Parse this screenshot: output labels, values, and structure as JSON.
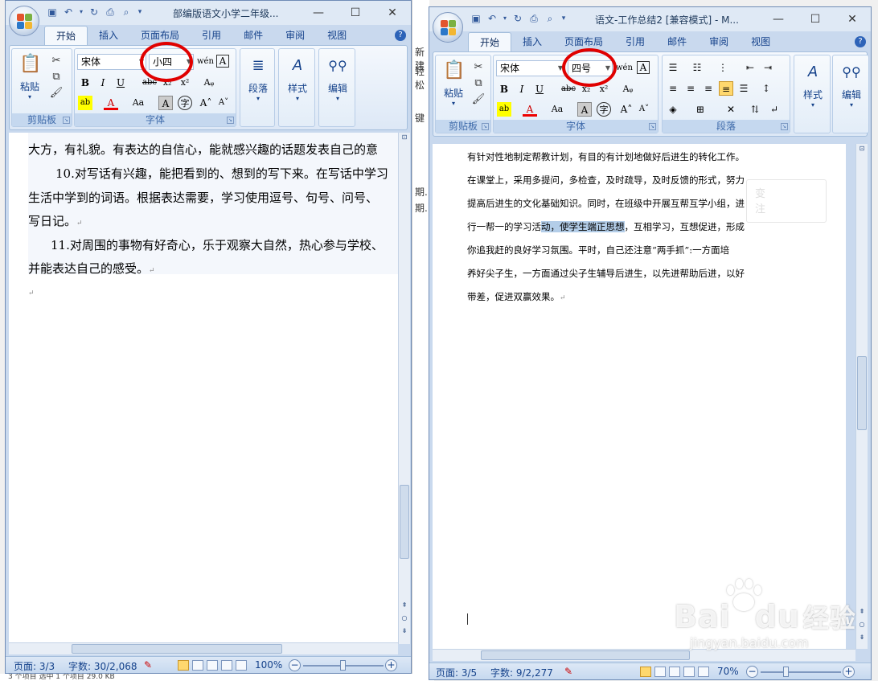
{
  "background": {
    "strip_items": [
      "新建",
      "轻松",
      "键",
      "期...",
      "期..."
    ],
    "bottom_text": "3 个项目    选中 1 个项目  29.0 KB"
  },
  "window1": {
    "title": "部编版语文小学二年级...",
    "tabs": [
      "开始",
      "插入",
      "页面布局",
      "引用",
      "邮件",
      "审阅",
      "视图"
    ],
    "active_tab": "开始",
    "groups": {
      "clipboard": "剪贴板",
      "font": "字体",
      "paragraph": "段落",
      "styles": "样式",
      "editing": "编辑"
    },
    "paste_label": "粘贴",
    "font_name": "宋体",
    "font_size": "小四",
    "doc_lines": [
      "大方，有礼貌。有表达的自信心，能就感兴趣的话题发表自己的意",
      "10.对写话有兴趣，能把看到的、想到的写下来。在写话中学习",
      "生活中学到的词语。根据表达需要，学习使用逗号、句号、问号、",
      "写日记。",
      "11.对周围的事物有好奇心，乐于观察大自然，热心参与学校、",
      "并能表达自己的感受。"
    ],
    "status": {
      "page": "页面: 3/3",
      "words": "字数: 30/2,068",
      "zoom": "100%"
    }
  },
  "window2": {
    "title": "语文-工作总结2 [兼容模式] - M...",
    "tabs": [
      "开始",
      "插入",
      "页面布局",
      "引用",
      "邮件",
      "审阅",
      "视图"
    ],
    "active_tab": "开始",
    "groups": {
      "clipboard": "剪贴板",
      "font": "字体",
      "paragraph": "段落",
      "styles": "样式",
      "editing": "编辑"
    },
    "paste_label": "粘贴",
    "font_name": "宋体",
    "font_size": "四号",
    "doc_lines": [
      "有针对性地制定帮教计划，有目的有计划地做好后进生的转化工作。",
      "在课堂上，采用多提问，多检查，及时疏导，及时反馈的形式，努力",
      "提高后进生的文化基础知识。同时，在班级中开展互帮互学小组，进",
      "行一帮一的学习活",
      "动，使学生端正思想",
      "，互相学习，互想促进，形成",
      "你追我赶的良好学习氛围。平时，自己还注意“两手抓”:一方面培",
      "养好尖子生，一方面通过尖子生辅导后进生，以先进帮助后进，以好",
      "带差，促进双赢效果。"
    ],
    "mini_toolbar": [
      "变",
      "注"
    ],
    "status": {
      "page": "页面: 3/5",
      "words": "字数: 9/2,277",
      "zoom": "70%"
    }
  },
  "watermark": {
    "main": "Bai",
    "main2": "du",
    "brand": "经验",
    "url": "jingyan.baidu.com"
  }
}
